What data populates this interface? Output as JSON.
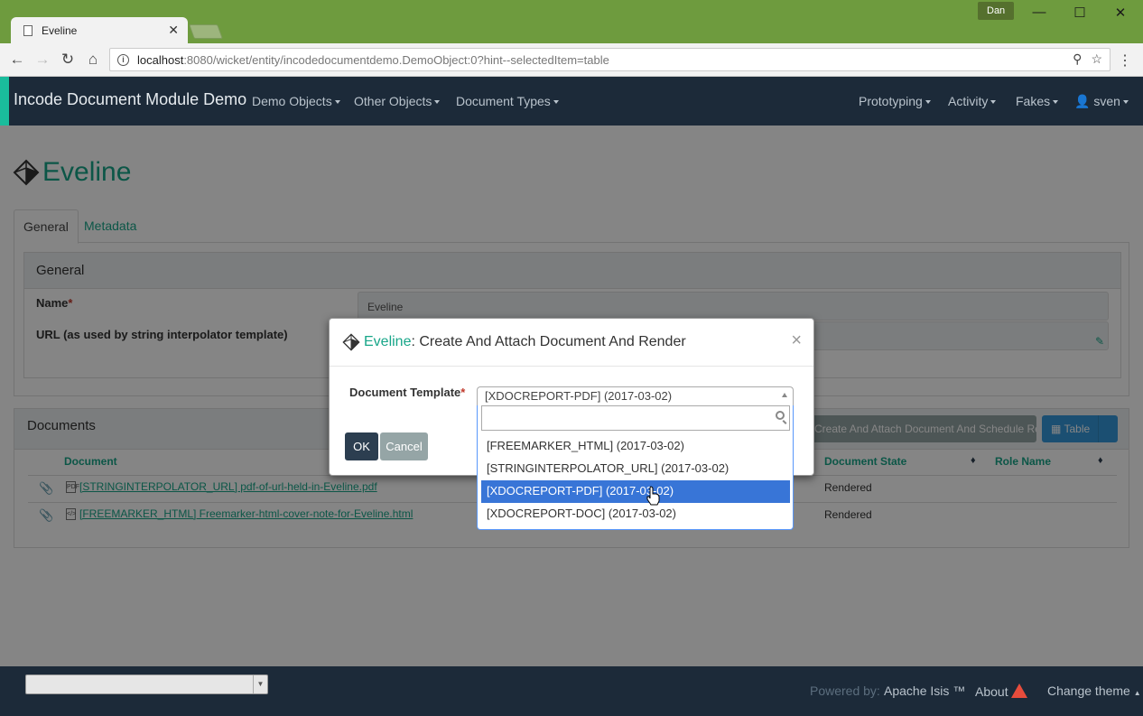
{
  "browser": {
    "tab_title": "Eveline",
    "profile": "Dan",
    "url_host": "localhost",
    "url_path": ":8080/wicket/entity/incodedocumentdemo.DemoObject:0?hint--selectedItem=table"
  },
  "navbar": {
    "brand": "Incode Document Module Demo",
    "left_menus": [
      "Demo Objects",
      "Other Objects",
      "Document Types"
    ],
    "right_menus": [
      "Prototyping",
      "Activity",
      "Fakes",
      "sven"
    ]
  },
  "page": {
    "title": "Eveline",
    "tabs": [
      "General",
      "Metadata"
    ],
    "general": {
      "heading": "General",
      "name_label": "Name",
      "name_value": "Eveline",
      "url_label": "URL (as used by string interpolator template)"
    },
    "documents": {
      "heading": "Documents",
      "action_button": "Create And Attach Document And Schedule Render",
      "table_button": "Table",
      "columns": [
        "Document",
        "Document State",
        "Role Name"
      ],
      "rows": [
        {
          "document": "[STRINGINTERPOLATOR_URL] pdf-of-url-held-in-Eveline.pdf",
          "state": "Rendered",
          "icon": "pdf-file-icon"
        },
        {
          "document": "[FREEMARKER_HTML] Freemarker-html-cover-note-for-Eveline.html",
          "state": "Rendered",
          "icon": "html-file-icon"
        }
      ]
    }
  },
  "modal": {
    "entity": "Eveline",
    "action": " : Create And Attach Document And Render",
    "field_label": "Document Template",
    "selected": "[XDOCREPORT-PDF] (2017-03-02)",
    "search_value": "",
    "options": [
      "[FREEMARKER_HTML] (2017-03-02)",
      "[STRINGINTERPOLATOR_URL] (2017-03-02)",
      "[XDOCREPORT-PDF] (2017-03-02)",
      "[XDOCREPORT-DOC] (2017-03-02)"
    ],
    "highlighted_index": 2,
    "ok_label": "OK",
    "cancel_label": "Cancel"
  },
  "footer": {
    "powered_by": "Powered by:",
    "isis": "Apache Isis ™",
    "about": "About",
    "change_theme": "Change theme"
  },
  "colors": {
    "accent": "#18a689",
    "navbar": "#1c2a39",
    "chrome": "#6e9b3e",
    "highlight": "#3875d7"
  }
}
